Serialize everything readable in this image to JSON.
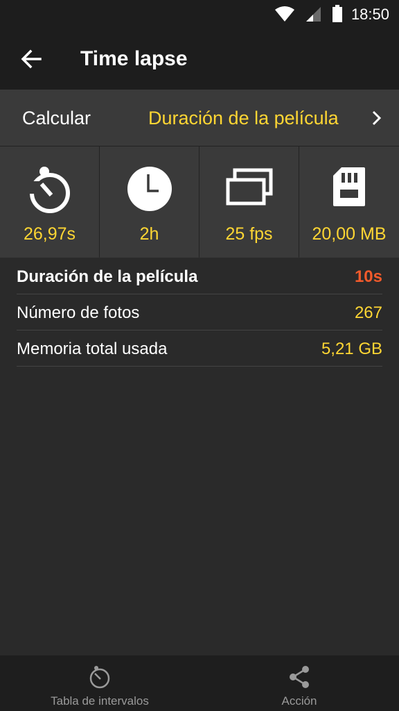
{
  "status_bar": {
    "time": "18:50",
    "icons": [
      "wifi-icon",
      "signal-icon",
      "battery-icon"
    ]
  },
  "app_bar": {
    "title": "Time lapse",
    "back_icon": "arrow-left-icon"
  },
  "calc_bar": {
    "label": "Calcular",
    "value": "Duración de la película"
  },
  "tiles": [
    {
      "icon": "interval-timer-icon",
      "value": "26,97s"
    },
    {
      "icon": "clock-icon",
      "value": "2h"
    },
    {
      "icon": "frames-icon",
      "value": "25 fps"
    },
    {
      "icon": "sd-card-icon",
      "value": "20,00 MB"
    }
  ],
  "results": [
    {
      "label": "Duración de la película",
      "value": "10s"
    },
    {
      "label": "Número de fotos",
      "value": "267"
    },
    {
      "label": "Memoria total usada",
      "value": "5,21 GB"
    }
  ],
  "bottom_nav": [
    {
      "label": "Tabla de intervalos",
      "icon": "timer-icon"
    },
    {
      "label": "Acción",
      "icon": "share-icon"
    }
  ],
  "colors": {
    "accent": "#ffd633",
    "highlight": "#f25a2b",
    "background": "#2a2a2a"
  }
}
